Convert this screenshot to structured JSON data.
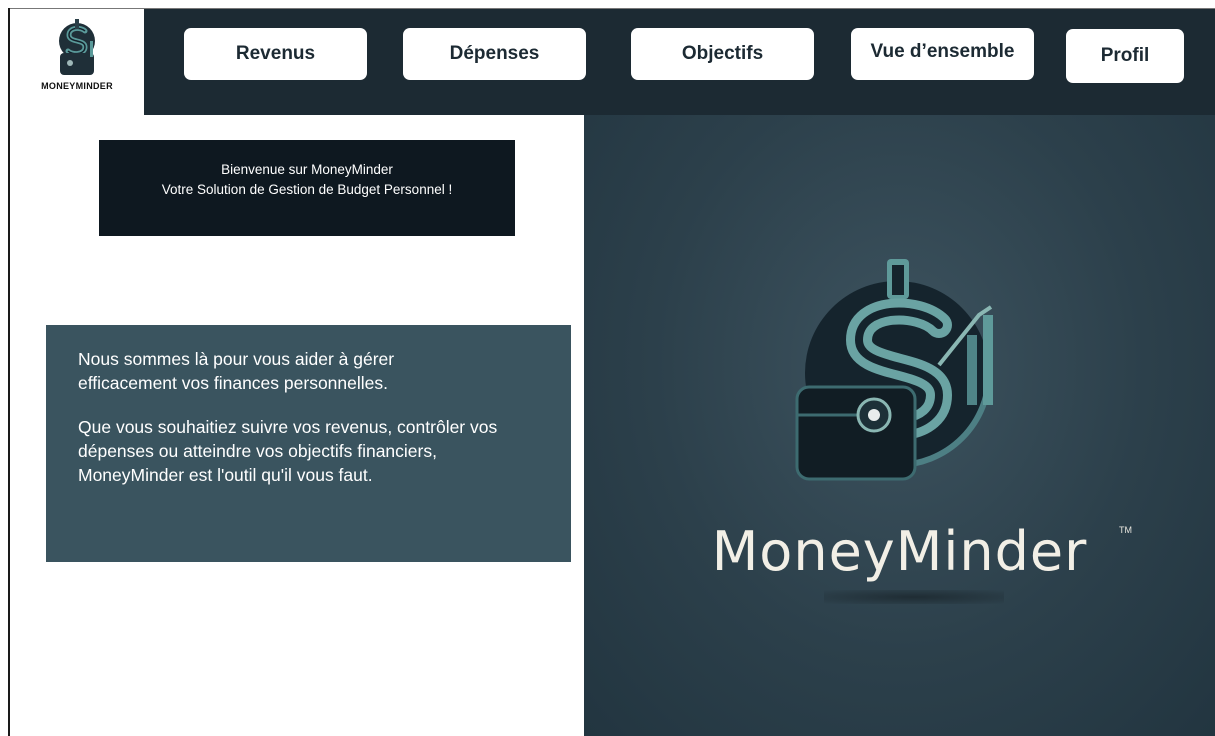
{
  "logo": {
    "text": "MONEYMINDER",
    "icon": "dollar-wallet-logo-icon"
  },
  "nav": {
    "revenus": "Revenus",
    "depenses": "Dépenses",
    "objectifs": "Objectifs",
    "vue": "Vue d’ensemble",
    "profil": "Profil"
  },
  "welcome": {
    "line1": "Bienvenue sur MoneyMinder",
    "line2": "Votre Solution de Gestion de Budget Personnel !"
  },
  "info": {
    "p1_line1": "Nous sommes là  pour vous aider à gérer",
    "p1_line2": "efficacement vos finances personnelles.",
    "p2_line1": "Que vous souhaitiez suivre vos revenus, contrôler vos",
    "p2_line2": "dépenses ou atteindre vos objectifs financiers,",
    "p2_line3": "MoneyMinder est l'outil qu'il vous faut."
  },
  "hero": {
    "brand": "MoneyMinder",
    "trademark": "TM"
  },
  "colors": {
    "header_bg": "#1c2a33",
    "hero_bg": "#2c404b",
    "welcome_bg": "#0e1820",
    "info_bg": "#3a545f",
    "logo_accent": "#5a9a9a"
  }
}
